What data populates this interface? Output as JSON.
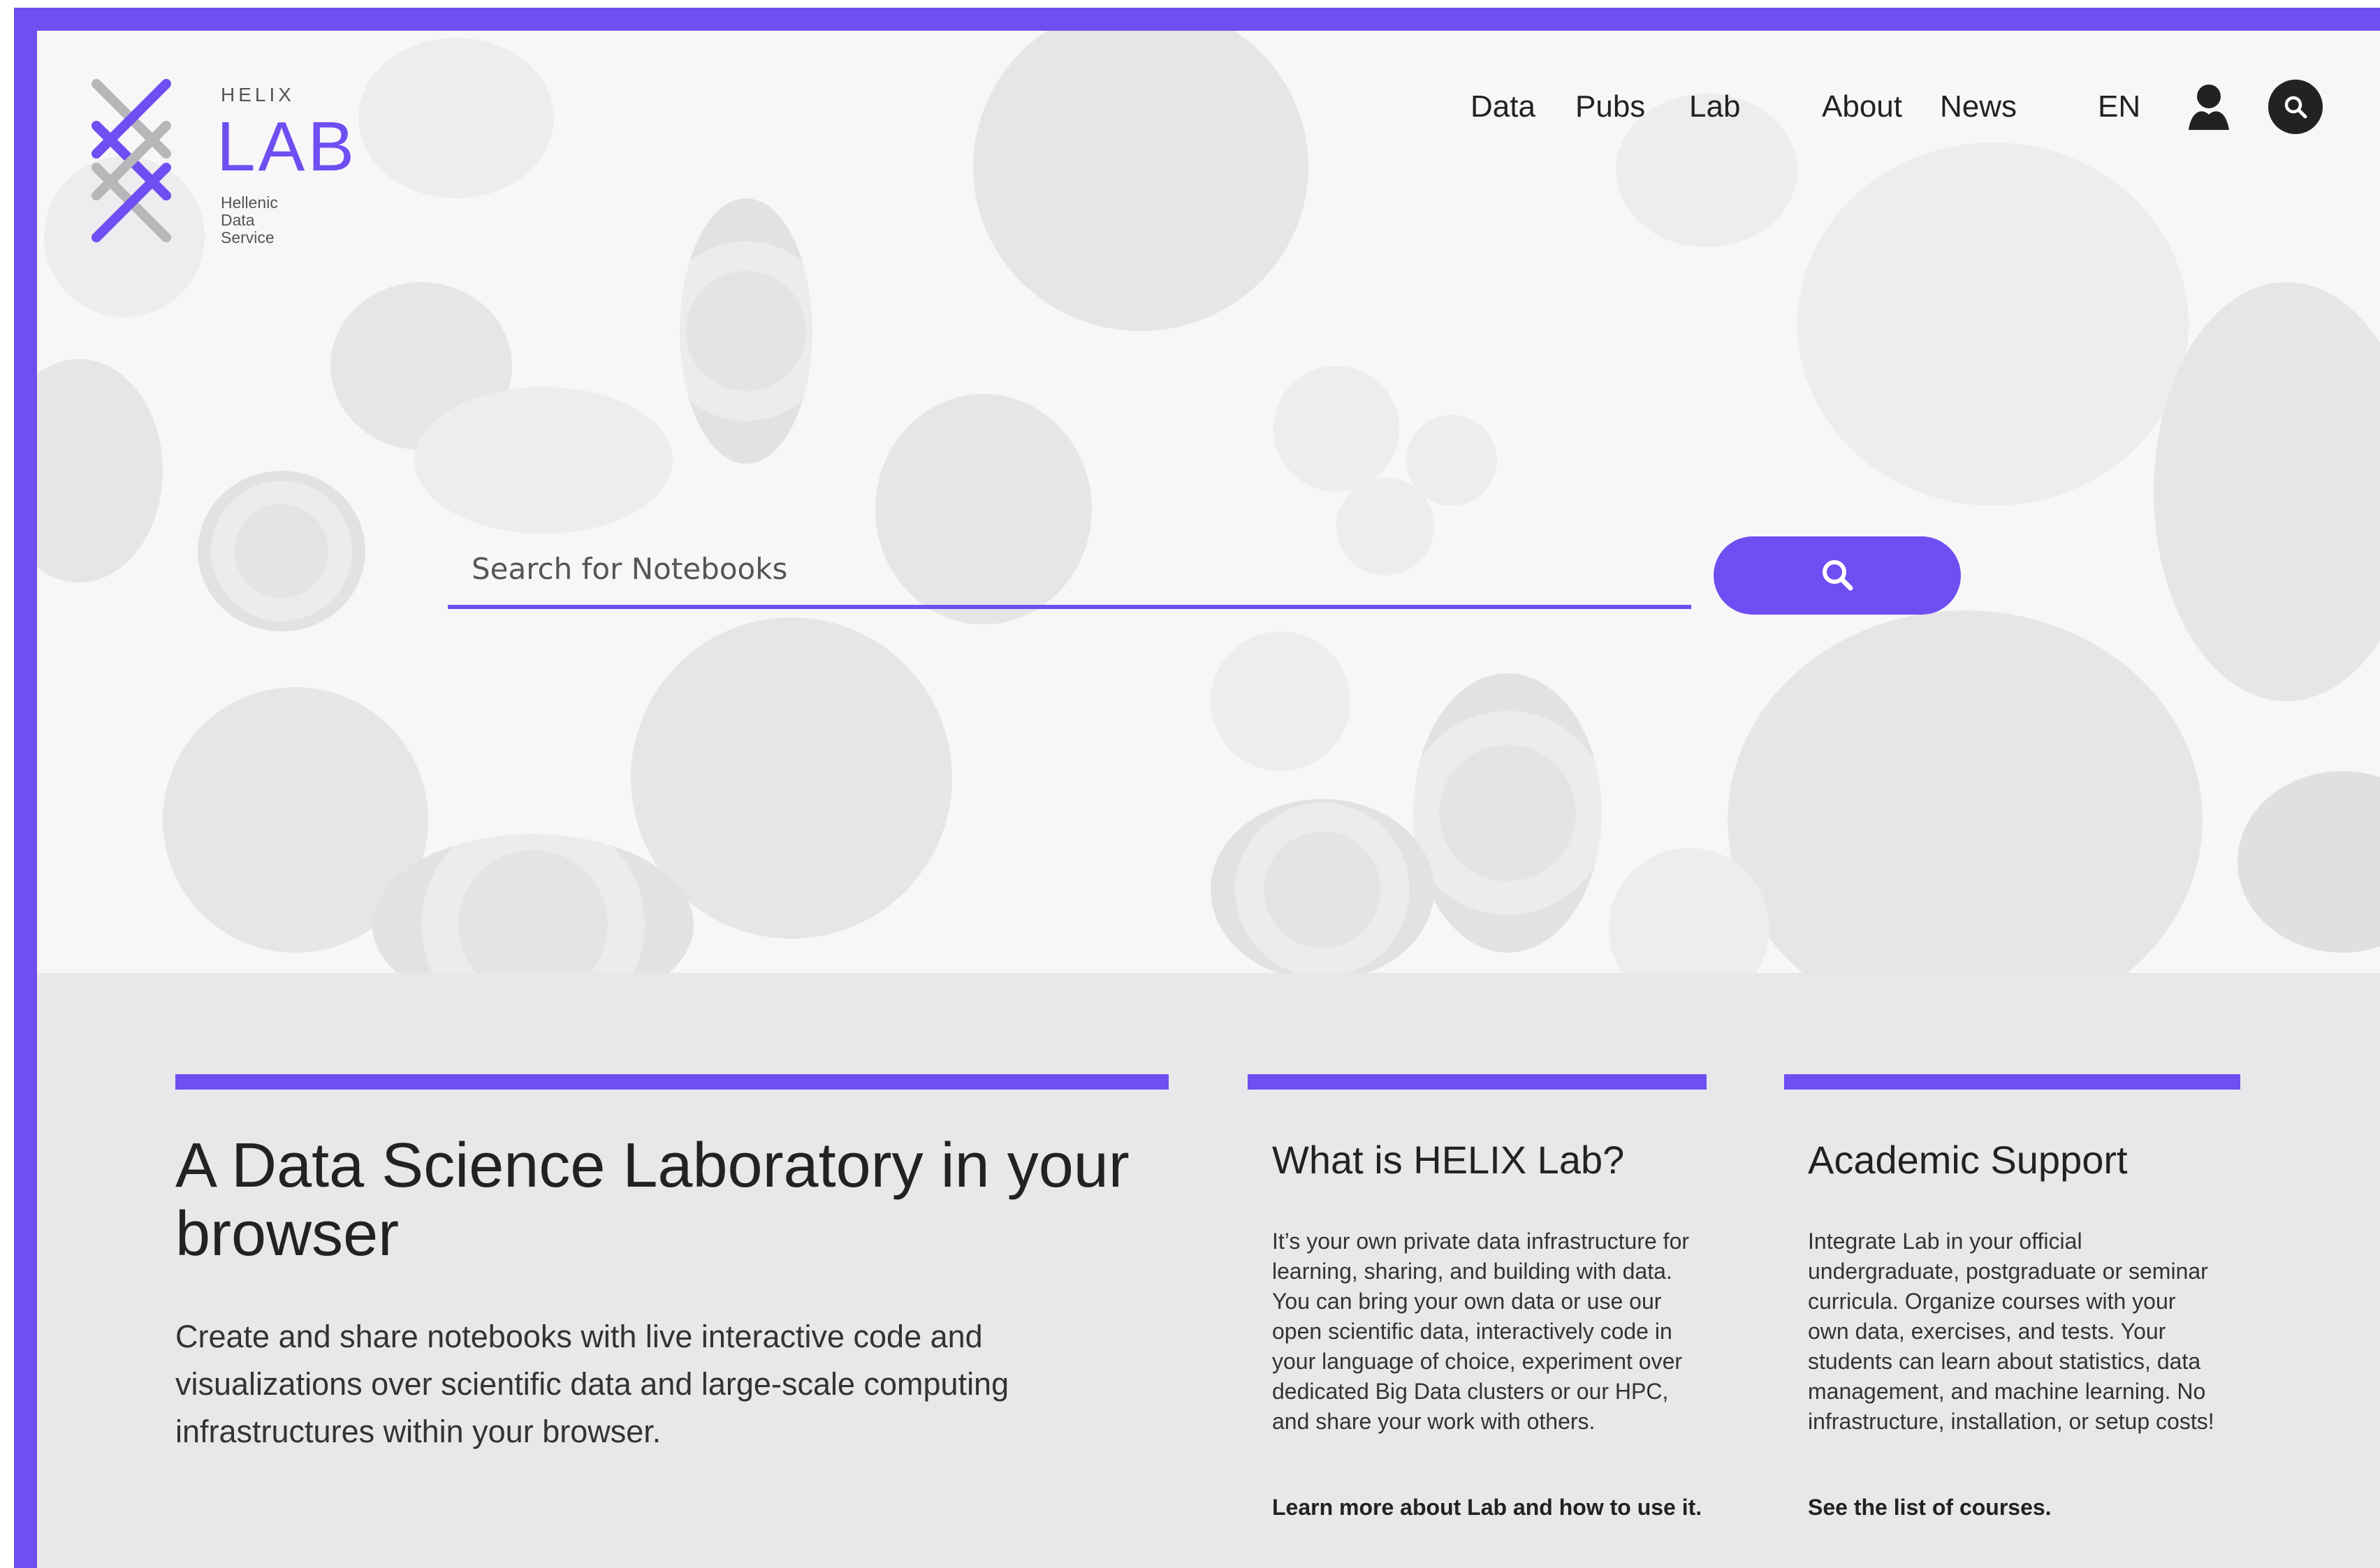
{
  "brand": {
    "small": "HELIX",
    "name": "LAB",
    "sub": [
      "Hellenic",
      "Data",
      "Service"
    ]
  },
  "nav": {
    "items": [
      "Data",
      "Pubs",
      "Lab",
      "About",
      "News"
    ],
    "language": "EN"
  },
  "search": {
    "placeholder": "Search for Notebooks"
  },
  "intro": {
    "title": "A Data Science Laboratory in your browser",
    "description": "Create and share notebooks with live interactive code and visualizations over scientific data and large-scale computing infrastructures within your browser."
  },
  "columns": [
    {
      "title": "What is HELIX Lab?",
      "text": "It’s your own private data infrastructure for learning, sharing, and building with data. You can bring your own data or use our open scientific data, interactively code in your language of choice, experiment over dedicated Big Data clusters or our HPC, and share your work with others.",
      "link": "Learn more about Lab and how to use it."
    },
    {
      "title": "Academic Support",
      "text": "Integrate Lab in your official undergraduate, postgraduate or seminar curricula. Organize courses with your own data, exercises, and tests. Your students can learn about statistics, data management, and machine learning. No infrastructure, installation, or setup costs!",
      "link": "See the list of courses."
    }
  ],
  "colors": {
    "accent": "#6f4ef2",
    "text": "#222222",
    "section_bg": "#e8e8ea"
  },
  "icons": [
    "helix-logo-icon",
    "user-icon",
    "search-icon"
  ]
}
